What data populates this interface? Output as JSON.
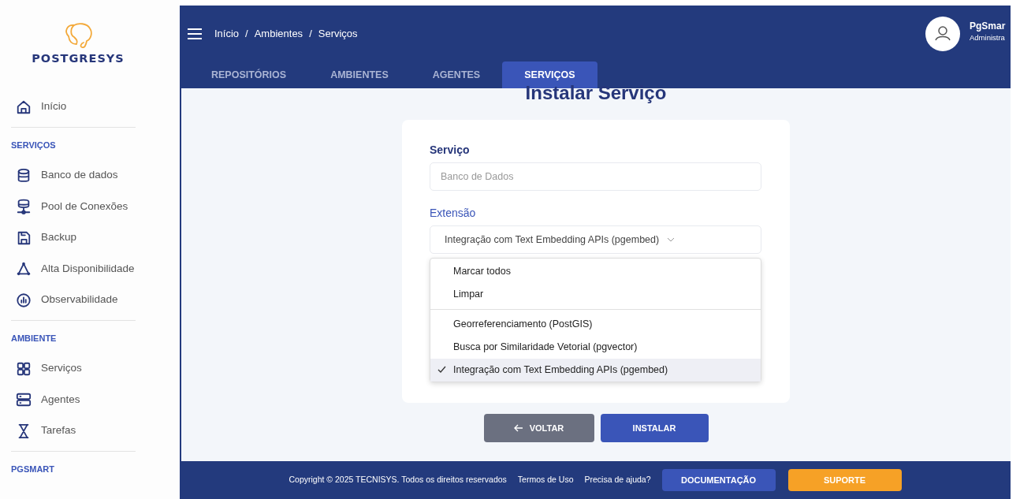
{
  "sidebar": {
    "brand": "POSTGRESYS",
    "sections": [
      {
        "items": [
          {
            "label": "Início",
            "kind": "home"
          }
        ]
      },
      {
        "heading": "SERVIÇOS",
        "items": [
          {
            "label": "Banco de dados",
            "kind": "database"
          },
          {
            "label": "Pool de Conexões",
            "kind": "pool"
          },
          {
            "label": "Backup",
            "kind": "save"
          },
          {
            "label": "Alta Disponibilidade",
            "kind": "nodes"
          },
          {
            "label": "Observabilidade",
            "kind": "chart"
          }
        ]
      },
      {
        "heading": "AMBIENTE",
        "items": [
          {
            "label": "Serviços",
            "kind": "grid"
          },
          {
            "label": "Agentes",
            "kind": "server"
          },
          {
            "label": "Tarefas",
            "kind": "hourglass"
          }
        ]
      },
      {
        "heading": "PGSMART"
      }
    ]
  },
  "header": {
    "breadcrumb": [
      "Início",
      "/",
      "Ambientes",
      "/",
      "Serviços"
    ],
    "user_name": "PgSmar",
    "user_role": "Administra"
  },
  "tabs": [
    {
      "label": "REPOSITÓRIOS",
      "selected": false
    },
    {
      "label": "AMBIENTES",
      "selected": false
    },
    {
      "label": "AGENTES",
      "selected": false
    },
    {
      "label": "SERVIÇOS",
      "selected": true
    }
  ],
  "form": {
    "title": "Instalar Serviço",
    "service": {
      "label": "Serviço",
      "placeholder": "Banco de Dados"
    },
    "extension": {
      "label": "Extensão",
      "value": "Integração com Text Embedding APIs (pgembed)",
      "menu": [
        {
          "kind": "action",
          "label": "Marcar todos"
        },
        {
          "kind": "action",
          "label": "Limpar"
        },
        {
          "kind": "option",
          "label": "Georreferenciamento (PostGIS)",
          "selected": false
        },
        {
          "kind": "option",
          "label": "Busca por Similaridade Vetorial (pgvector)",
          "selected": false
        },
        {
          "kind": "option",
          "label": "Integração com Text Embedding APIs (pgembed)",
          "selected": true
        }
      ]
    }
  },
  "buttons": [
    {
      "kind": "back",
      "label": "VOLTAR"
    },
    {
      "kind": "primary",
      "label": "INSTALAR"
    }
  ],
  "footer": {
    "texts": [
      "Copyright © 2025 TECNISYS.  Todos os direitos reservados",
      "Termos de Uso",
      "Precisa de ajuda?"
    ],
    "buttons": [
      {
        "kind": "primary",
        "label": "DOCUMENTAÇÃO"
      },
      {
        "kind": "warning",
        "label": "SUPORTE"
      }
    ]
  }
}
